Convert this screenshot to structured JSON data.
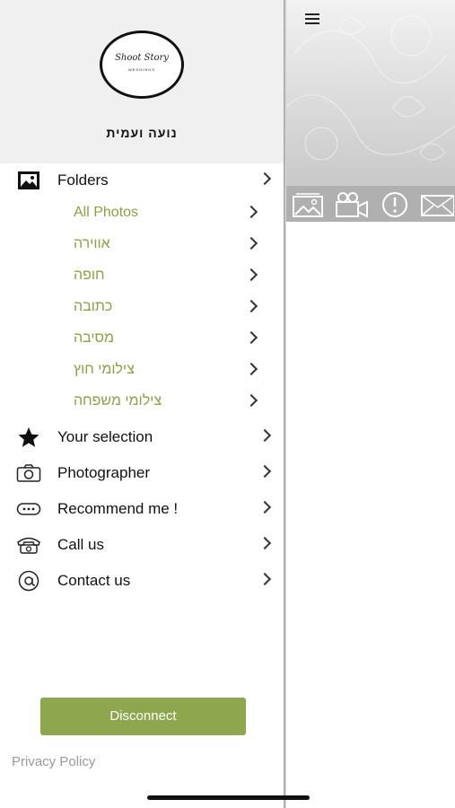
{
  "profile": {
    "logo_text": "Shoot Story",
    "logo_sub": "WEDDINGS",
    "name": "נועה ועמית"
  },
  "menu": {
    "folders": "Folders",
    "subfolders": [
      "All Photos",
      "אווירה",
      "חופה",
      "כתובה",
      "מסיבה",
      "צילומי חוץ",
      "צילומי משפחה"
    ],
    "your_selection": "Your selection",
    "photographer": "Photographer",
    "recommend": "Recommend me !",
    "call_us": "Call us",
    "contact_us": "Contact us"
  },
  "disconnect_label": "Disconnect",
  "privacy_label": "Privacy Policy",
  "colors": {
    "accent": "#8ea64e",
    "subfolder_text": "#8aa04a",
    "profile_bg": "#f0f0f0",
    "iconbar_bg": "#b0b0b0"
  },
  "icons": {
    "folders": "picture-icon",
    "selection": "star-icon",
    "photographer": "camera-icon",
    "recommend": "dots-icon",
    "call": "phone-icon",
    "contact": "at-icon",
    "iconbar": [
      "gallery-icon",
      "video-camera-icon",
      "info-icon",
      "envelope-icon"
    ]
  }
}
